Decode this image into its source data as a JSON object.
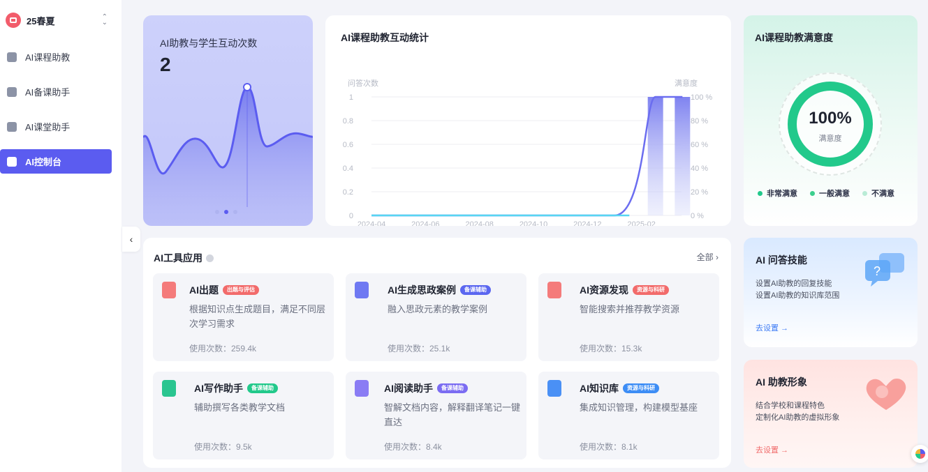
{
  "sidebar": {
    "course_name": "25春夏",
    "items": [
      {
        "label": "AI课程助教",
        "icon": "assistant-icon"
      },
      {
        "label": "AI备课助手",
        "icon": "lesson-prep-icon"
      },
      {
        "label": "AI课堂助手",
        "icon": "classroom-icon"
      },
      {
        "label": "AI控制台",
        "icon": "console-icon"
      }
    ],
    "active_index": 3
  },
  "interaction": {
    "title": "AI助教与学生互动次数",
    "value": "2"
  },
  "chart_data": {
    "type": "line",
    "title": "AI课程助教互动统计",
    "ylabel": "问答次数",
    "y2label": "满意度",
    "x_ticks": [
      "2024-04",
      "2024-06",
      "2024-08",
      "2024-10",
      "2024-12",
      "2025-02"
    ],
    "y_ticks": [
      "0",
      "0.2",
      "0.4",
      "0.6",
      "0.8",
      "1"
    ],
    "y2_ticks": [
      "0 %",
      "20 %",
      "40 %",
      "60 %",
      "80 %",
      "100 %"
    ],
    "ylim": [
      0,
      1
    ],
    "y2lim": [
      0,
      100
    ],
    "series": [
      {
        "kind": "line",
        "x": [
          "2024-04",
          "2024-06",
          "2024-08",
          "2024-10",
          "2024-12",
          "2025-01",
          "2025-02",
          "2025-03"
        ],
        "values": [
          0,
          0,
          0,
          0,
          0,
          0,
          1,
          1
        ]
      },
      {
        "kind": "bar",
        "x": [
          "2025-02",
          "2025-03"
        ],
        "values": [
          100,
          100
        ]
      }
    ]
  },
  "satisfaction": {
    "title": "AI课程助教满意度",
    "percent": "100%",
    "subtitle": "满意度",
    "legend": [
      {
        "label": "非常满意",
        "color": "#22c98b"
      },
      {
        "label": "一般满意",
        "color": "#3ccf8e"
      },
      {
        "label": "不满意",
        "color": "#b9ecd6"
      }
    ]
  },
  "tools": {
    "title": "AI工具应用",
    "all_label": "全部 ›",
    "items": [
      {
        "name": "AI出题",
        "tag": "出题与评估",
        "tag_color": "#f26b6b",
        "icon_color": "#f47b7b",
        "desc": "根据知识点生成题目，满足不同层次学习需求",
        "usage": "使用次数：259.4k"
      },
      {
        "name": "AI生成思政案例",
        "tag": "备课辅助",
        "tag_color": "#5b67f0",
        "icon_color": "#6f79f2",
        "desc": "融入思政元素的教学案例",
        "usage": "使用次数：25.1k"
      },
      {
        "name": "AI资源发现",
        "tag": "资源与科研",
        "tag_color": "#f26b6b",
        "icon_color": "#f47b7b",
        "desc": "智能搜索并推荐教学资源",
        "usage": "使用次数：15.3k"
      },
      {
        "name": "AI写作助手",
        "tag": "备课辅助",
        "tag_color": "#22c98b",
        "icon_color": "#2ac590",
        "desc": "辅助撰写各类教学文档",
        "usage": "使用次数：9.5k"
      },
      {
        "name": "AI阅读助手",
        "tag": "备课辅助",
        "tag_color": "#7b6cf2",
        "icon_color": "#8a7cf4",
        "desc": "智解文档内容，解释翻译笔记一键直达",
        "usage": "使用次数：8.4k"
      },
      {
        "name": "AI知识库",
        "tag": "资源与科研",
        "tag_color": "#3d8df5",
        "icon_color": "#4a90f5",
        "desc": "集成知识管理，构建模型基座",
        "usage": "使用次数：8.1k"
      }
    ]
  },
  "qa_skill": {
    "title": "AI 问答技能",
    "lines": [
      "设置AI助教的回复技能",
      "设置AI助教的知识库范围"
    ],
    "link": "去设置 →"
  },
  "avatar": {
    "title": "AI 助教形象",
    "lines": [
      "结合学校和课程特色",
      "定制化AI助教的虚拟形象"
    ],
    "link": "去设置 →"
  }
}
